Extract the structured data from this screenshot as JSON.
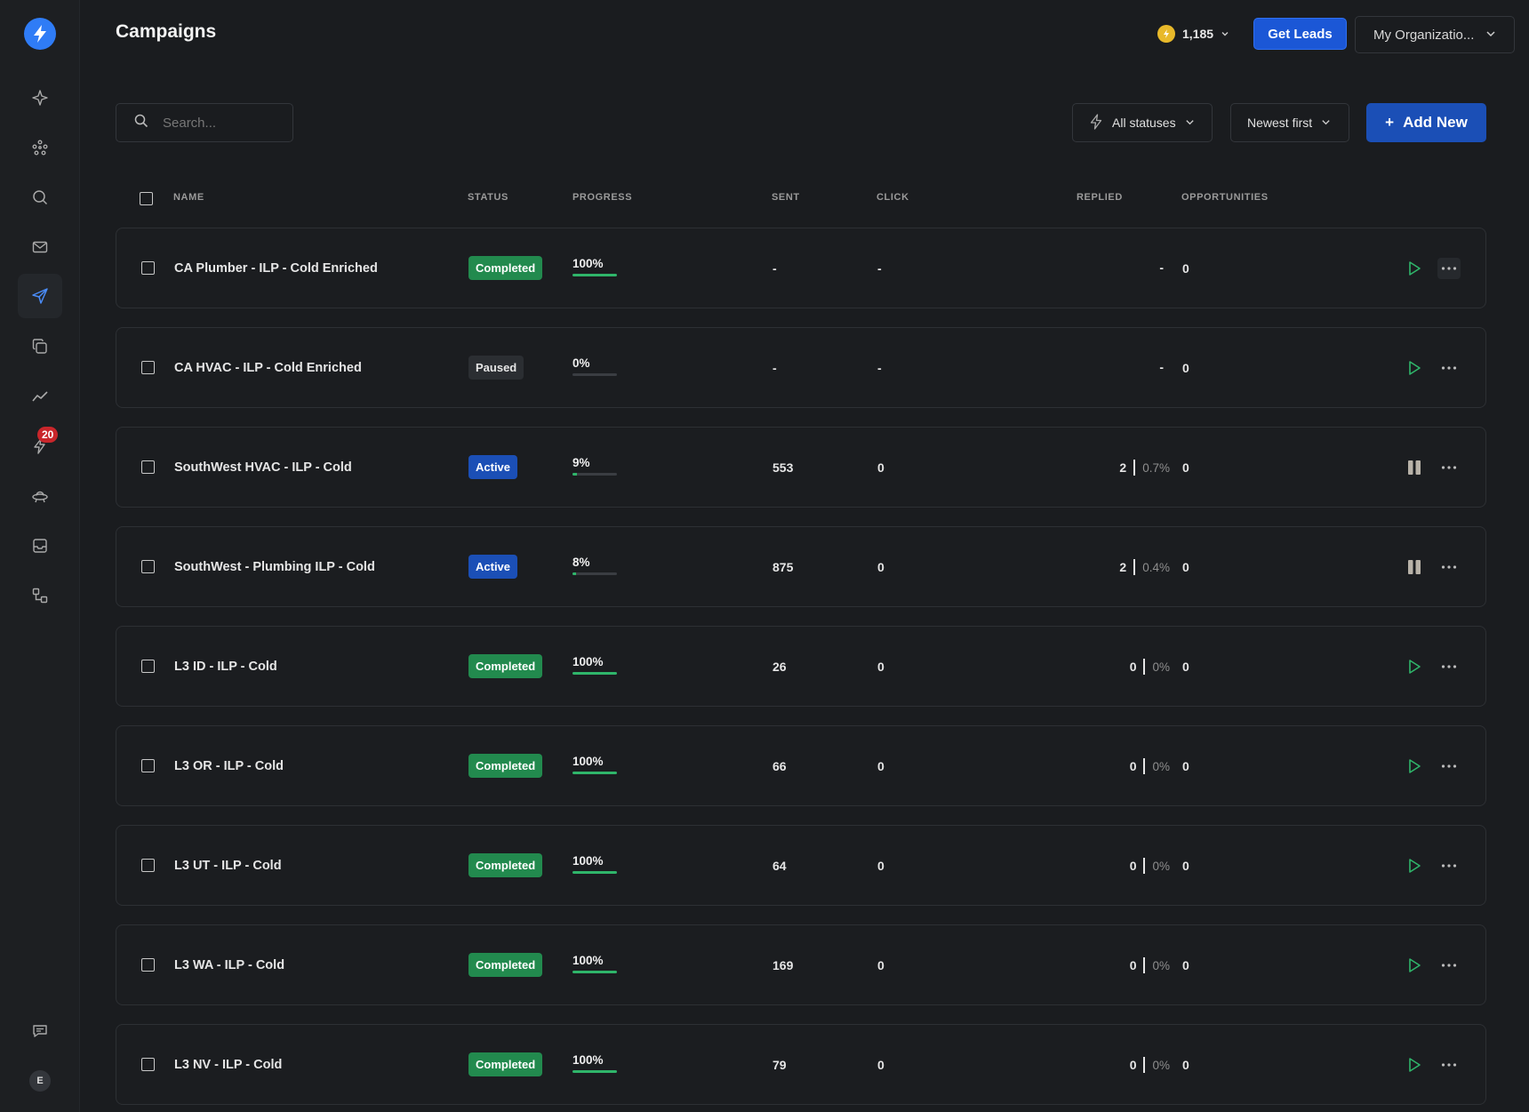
{
  "header": {
    "title": "Campaigns",
    "credits": "1,185",
    "get_leads_label": "Get Leads",
    "org_label": "My Organizatio..."
  },
  "toolbar": {
    "search_placeholder": "Search...",
    "status_filter": "All statuses",
    "sort_label": "Newest first",
    "add_new_label": "Add New",
    "add_plus": "+"
  },
  "sidebar": {
    "notifications_badge": "20",
    "avatar_initial": "E"
  },
  "columns": {
    "name": "NAME",
    "status": "STATUS",
    "progress": "PROGRESS",
    "sent": "SENT",
    "click": "CLICK",
    "replied": "REPLIED",
    "opportunities": "OPPORTUNITIES"
  },
  "campaigns": [
    {
      "name": "CA Plumber - ILP - Cold Enriched",
      "status": "Completed",
      "progress": "100%",
      "progress_value": 100,
      "sent": "-",
      "click": "-",
      "replied": "-",
      "reply_rate": "",
      "opportunities": "0",
      "action": "play"
    },
    {
      "name": "CA HVAC - ILP - Cold Enriched",
      "status": "Paused",
      "progress": "0%",
      "progress_value": 0,
      "sent": "-",
      "click": "-",
      "replied": "-",
      "reply_rate": "",
      "opportunities": "0",
      "action": "play"
    },
    {
      "name": "SouthWest HVAC - ILP - Cold",
      "status": "Active",
      "progress": "9%",
      "progress_value": 9,
      "sent": "553",
      "click": "0",
      "replied": "2",
      "reply_rate": "0.7%",
      "opportunities": "0",
      "action": "pause"
    },
    {
      "name": "SouthWest - Plumbing ILP - Cold",
      "status": "Active",
      "progress": "8%",
      "progress_value": 8,
      "sent": "875",
      "click": "0",
      "replied": "2",
      "reply_rate": "0.4%",
      "opportunities": "0",
      "action": "pause"
    },
    {
      "name": "L3 ID - ILP - Cold",
      "status": "Completed",
      "progress": "100%",
      "progress_value": 100,
      "sent": "26",
      "click": "0",
      "replied": "0",
      "reply_rate": "0%",
      "opportunities": "0",
      "action": "play"
    },
    {
      "name": "L3 OR - ILP - Cold",
      "status": "Completed",
      "progress": "100%",
      "progress_value": 100,
      "sent": "66",
      "click": "0",
      "replied": "0",
      "reply_rate": "0%",
      "opportunities": "0",
      "action": "play"
    },
    {
      "name": "L3 UT - ILP - Cold",
      "status": "Completed",
      "progress": "100%",
      "progress_value": 100,
      "sent": "64",
      "click": "0",
      "replied": "0",
      "reply_rate": "0%",
      "opportunities": "0",
      "action": "play"
    },
    {
      "name": "L3 WA - ILP - Cold",
      "status": "Completed",
      "progress": "100%",
      "progress_value": 100,
      "sent": "169",
      "click": "0",
      "replied": "0",
      "reply_rate": "0%",
      "opportunities": "0",
      "action": "play"
    },
    {
      "name": "L3 NV - ILP - Cold",
      "status": "Completed",
      "progress": "100%",
      "progress_value": 100,
      "sent": "79",
      "click": "0",
      "replied": "0",
      "reply_rate": "0%",
      "opportunities": "0",
      "action": "play"
    }
  ],
  "colors": {
    "completed": "#228a4e",
    "active": "#1b4fb6",
    "paused": "#2b2e32",
    "accent": "#2f7cf6",
    "progress_fill": "#2fb56a"
  }
}
